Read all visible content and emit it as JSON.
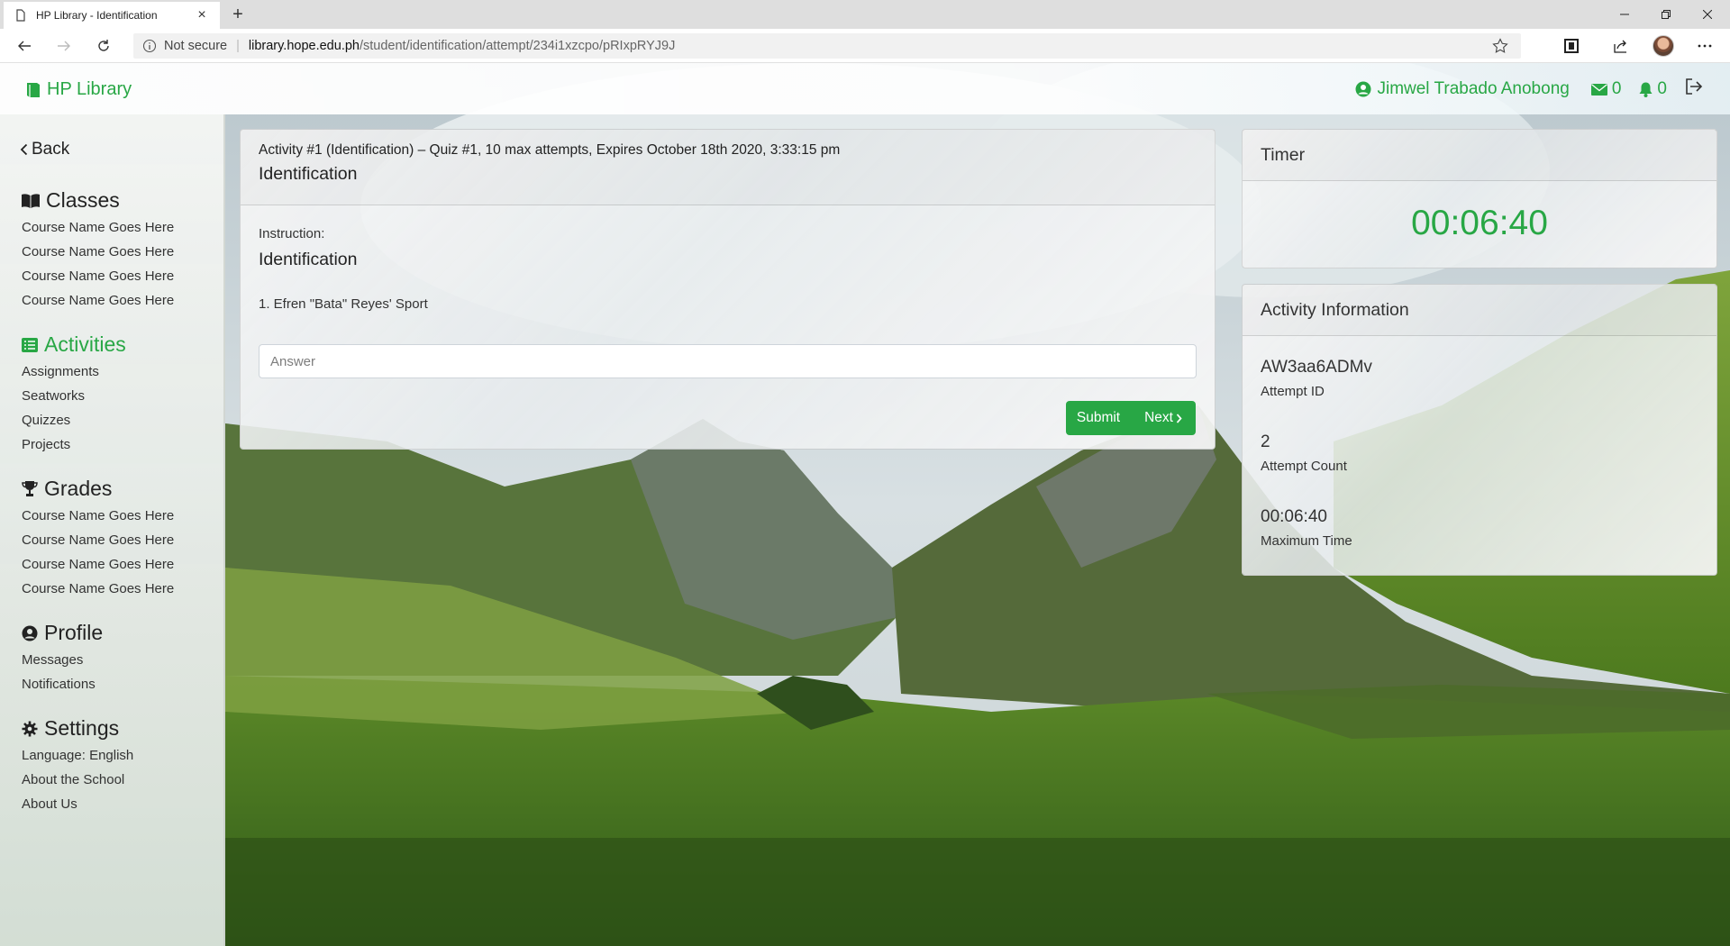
{
  "browser": {
    "tab_title": "HP Library - Identification",
    "security_label": "Not secure",
    "url_host": "library.hope.edu.ph",
    "url_path": "/student/identification/attempt/234i1xzcpo/pRIxpRYJ9J"
  },
  "navbar": {
    "brand": "HP Library",
    "user_name": "Jimwel Trabado Anobong",
    "messages_count": "0",
    "notifications_count": "0"
  },
  "sidebar": {
    "back_label": "Back",
    "classes": {
      "title": "Classes",
      "items": [
        "Course Name Goes Here",
        "Course Name Goes Here",
        "Course Name Goes Here",
        "Course Name Goes Here"
      ]
    },
    "activities": {
      "title": "Activities",
      "items": [
        "Assignments",
        "Seatworks",
        "Quizzes",
        "Projects"
      ]
    },
    "grades": {
      "title": "Grades",
      "items": [
        "Course Name Goes Here",
        "Course Name Goes Here",
        "Course Name Goes Here",
        "Course Name Goes Here"
      ]
    },
    "profile": {
      "title": "Profile",
      "items": [
        "Messages",
        "Notifications"
      ]
    },
    "settings": {
      "title": "Settings",
      "items": [
        "Language: English",
        "About the School",
        "About Us"
      ]
    }
  },
  "quiz": {
    "meta": "Activity #1 (Identification) – Quiz #1, 10 max attempts, Expires October 18th 2020, 3:33:15 pm",
    "title": "Identification",
    "instruction_label": "Instruction:",
    "instruction_title": "Identification",
    "question": "1. Efren \"Bata\" Reyes' Sport",
    "answer_placeholder": "Answer",
    "answer_value": "",
    "submit_label": "Submit",
    "next_label": "Next"
  },
  "timer": {
    "title": "Timer",
    "value": "00:06:40"
  },
  "activity_info": {
    "title": "Activity Information",
    "attempt_id": "AW3aa6ADMv",
    "attempt_id_label": "Attempt ID",
    "attempt_count": "2",
    "attempt_count_label": "Attempt Count",
    "maximum_time": "00:06:40",
    "maximum_time_label": "Maximum Time"
  },
  "colors": {
    "accent": "#28a745",
    "sidebar_bg": "#e8ece8"
  }
}
